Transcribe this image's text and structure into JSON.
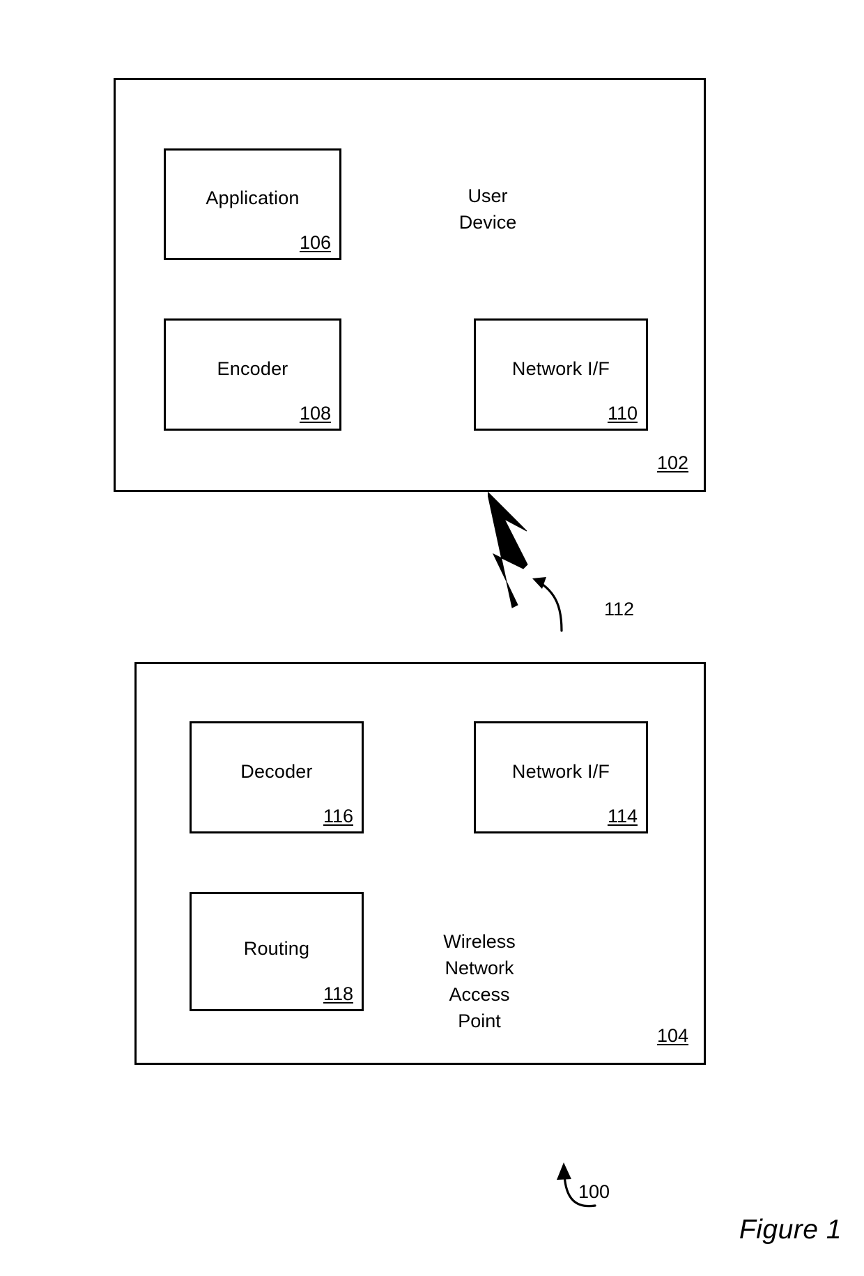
{
  "figure": {
    "caption": "Figure 1",
    "system_ref": "100"
  },
  "user_device": {
    "caption": "User\nDevice",
    "ref": "102",
    "components": [
      {
        "label": "Application",
        "ref": "106"
      },
      {
        "label": "Encoder",
        "ref": "108"
      },
      {
        "label": "Network I/F",
        "ref": "110"
      }
    ]
  },
  "wireless_link": {
    "ref": "112"
  },
  "access_point": {
    "caption": "Wireless\nNetwork\nAccess\nPoint",
    "ref": "104",
    "components": [
      {
        "label": "Decoder",
        "ref": "116"
      },
      {
        "label": "Network I/F",
        "ref": "114"
      },
      {
        "label": "Routing",
        "ref": "118"
      }
    ]
  },
  "colors": {
    "line": "#000000",
    "background": "#ffffff"
  }
}
